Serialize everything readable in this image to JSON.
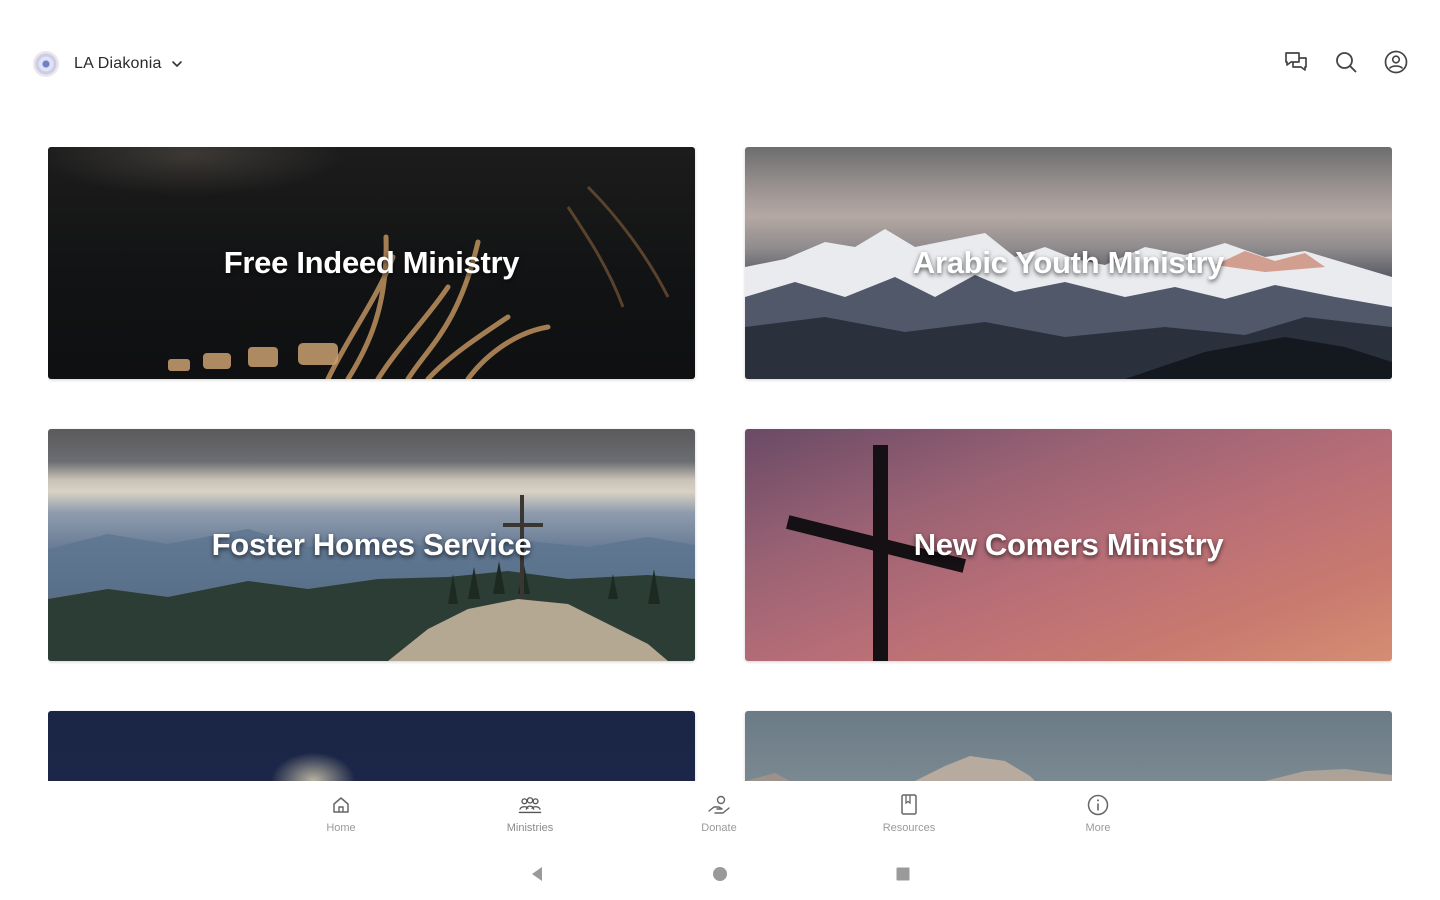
{
  "header": {
    "org_name": "LA Diakonia",
    "icons": [
      "chat-icon",
      "search-icon",
      "account-icon"
    ]
  },
  "cards": [
    {
      "title": "Free Indeed Ministry"
    },
    {
      "title": "Arabic Youth Ministry"
    },
    {
      "title": "Foster Homes Service"
    },
    {
      "title": "New Comers Ministry"
    },
    {
      "title": ""
    },
    {
      "title": ""
    }
  ],
  "bottom_nav": {
    "items": [
      {
        "label": "Home",
        "icon": "home-icon"
      },
      {
        "label": "Ministries",
        "icon": "ministries-icon"
      },
      {
        "label": "Donate",
        "icon": "donate-icon"
      },
      {
        "label": "Resources",
        "icon": "resources-icon"
      },
      {
        "label": "More",
        "icon": "info-icon"
      }
    ]
  },
  "system_nav": [
    "back-icon",
    "home-circle-icon",
    "recents-icon"
  ],
  "colors": {
    "text_primary": "#2a2a2a",
    "icon": "#444444",
    "nav_label": "#9a9a9a"
  }
}
